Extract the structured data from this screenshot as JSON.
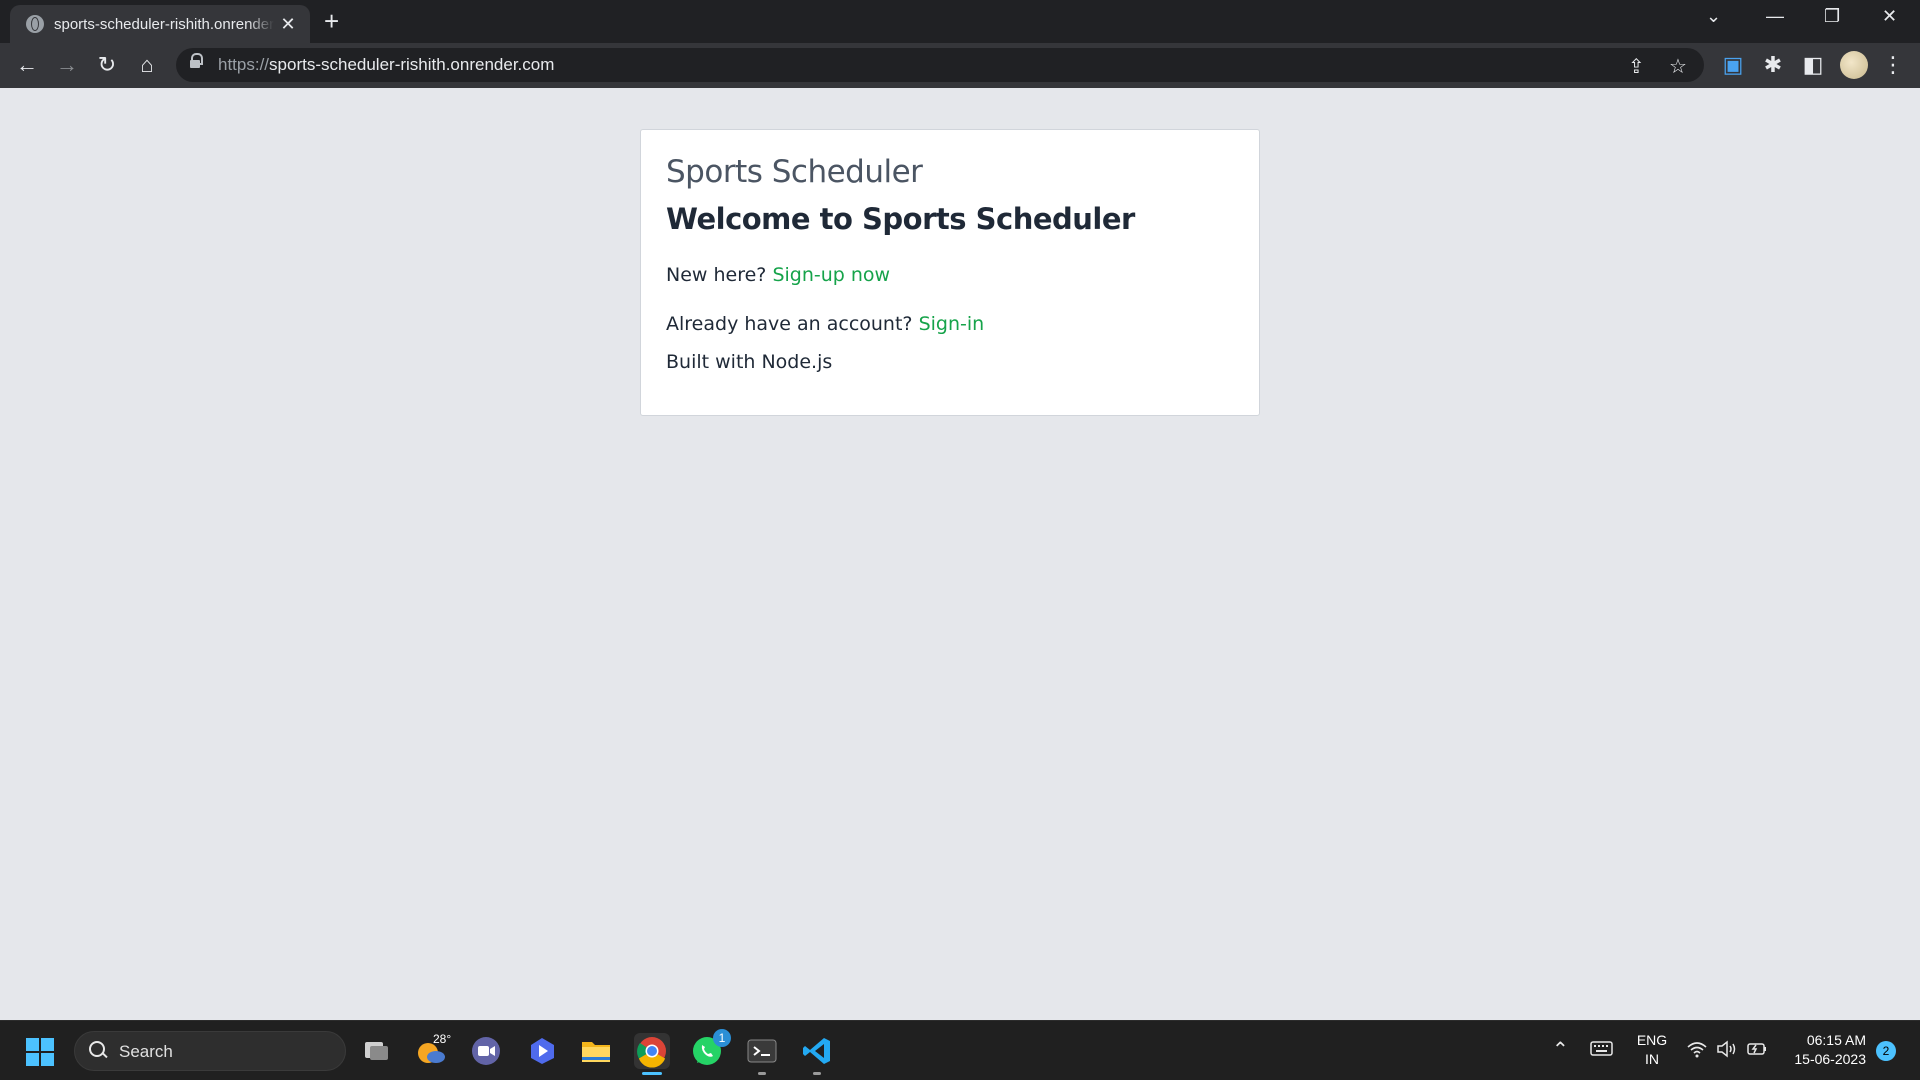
{
  "browser": {
    "tab_title": "sports-scheduler-rishith.onrender.com",
    "tab_close": "✕",
    "new_tab": "+",
    "url_scheme": "https://",
    "url_host": "sports-scheduler-rishith.onrender.com",
    "window_controls": [
      "⌄",
      "—",
      "❐",
      "✕"
    ]
  },
  "page": {
    "brand": "Sports Scheduler",
    "headline": "Welcome to Sports Scheduler",
    "new_here_text": "New here?",
    "signup_link": "Sign-up now",
    "have_account_text": "Already have an account?",
    "signin_link": "Sign-in",
    "footer_text": "Built with Node.js",
    "link_color": "#16a34a"
  },
  "taskbar": {
    "search_label": "Search",
    "weather_temp": "28°",
    "whatsapp_badge": "1",
    "language_top": "ENG",
    "language_bottom": "IN",
    "time": "06:15 AM",
    "date": "15-06-2023",
    "notification_count": "2"
  }
}
